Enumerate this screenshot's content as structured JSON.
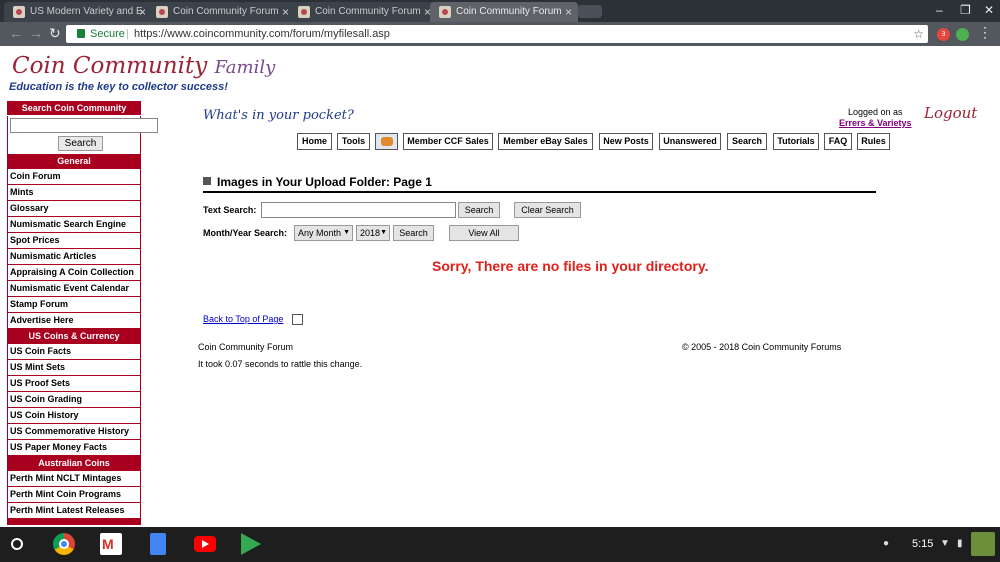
{
  "browser": {
    "tabs": [
      {
        "title": "US Modern Variety and E"
      },
      {
        "title": "Coin Community Forum"
      },
      {
        "title": "Coin Community Forum"
      },
      {
        "title": "Coin Community Forum"
      }
    ],
    "security_label": "Secure",
    "url": "https://www.coincommunity.com/forum/myfilesall.asp",
    "extension_badge": "3"
  },
  "site": {
    "logo_main": "Coin Community",
    "logo_family": "Family",
    "tagline": "Education is the key to collector success!",
    "pocket_text": "What's in your pocket?",
    "logged_on_label": "Logged on as",
    "username": "Errers & Varietys",
    "logout_label": "Logout"
  },
  "sidebar": {
    "search_title": "Search Coin Community",
    "search_button": "Search",
    "general_header": "General",
    "general_items": [
      "Coin Forum",
      "Mints",
      "Glossary",
      "Numismatic Search Engine",
      "Spot Prices",
      "Numismatic Articles",
      "Appraising A Coin Collection",
      "Numismatic Event Calendar",
      "Stamp Forum",
      "Advertise Here"
    ],
    "us_header": "US Coins & Currency",
    "us_items": [
      "US Coin Facts",
      "US Mint Sets",
      "US Proof Sets",
      "US Coin Grading",
      "US Coin History",
      "US Commemorative History",
      "US Paper Money Facts"
    ],
    "aus_header": "Australian Coins",
    "aus_items": [
      "Perth Mint NCLT Mintages",
      "Perth Mint Coin Programs",
      "Perth Mint Latest Releases"
    ]
  },
  "nav": {
    "home": "Home",
    "tools": "Tools",
    "ccf_sales": "Member CCF Sales",
    "ebay_sales": "Member eBay Sales",
    "new_posts": "New Posts",
    "unanswered": "Unanswered",
    "search": "Search",
    "tutorials": "Tutorials",
    "faq": "FAQ",
    "rules": "Rules"
  },
  "main": {
    "heading": "Images in Your Upload Folder: Page 1",
    "text_search_label": "Text Search:",
    "search_button": "Search",
    "clear_search_button": "Clear Search",
    "month_year_label": "Month/Year Search:",
    "month_value": "Any Month",
    "year_value": "2018",
    "month_search_button": "Search",
    "view_all_button": "View All",
    "no_files_message": "Sorry, There are no files in your directory.",
    "back_to_top": "Back to Top of Page"
  },
  "footer": {
    "left": "Coin Community Forum",
    "copyright": "© 2005 - 2018 Coin Community Forums",
    "timing": "It took 0.07 seconds to rattle this change."
  },
  "shelf": {
    "apps": [
      "chrome-icon",
      "gmail-icon",
      "docs-icon",
      "youtube-icon",
      "play-store-icon"
    ],
    "clock": "5:15"
  },
  "colors": {
    "brand_red": "#a8001e",
    "logo_blue": "#1f3b8a",
    "error_red": "#e0201b"
  }
}
